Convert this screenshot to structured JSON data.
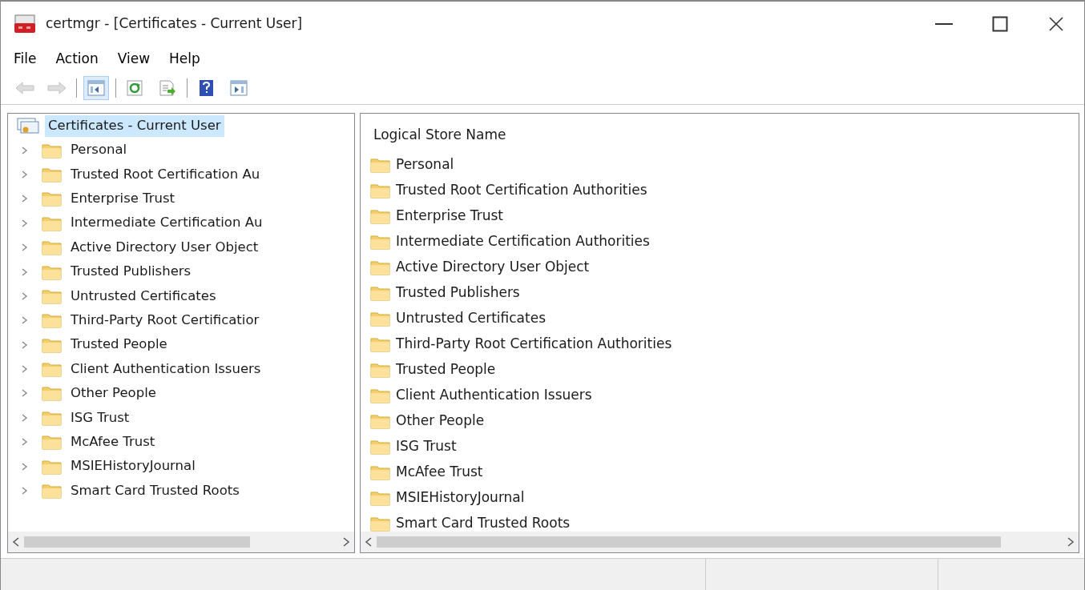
{
  "window": {
    "title": "certmgr - [Certificates - Current User]"
  },
  "menu": [
    "File",
    "Action",
    "View",
    "Help"
  ],
  "toolbar": [
    {
      "kind": "back",
      "disabled": true,
      "pressed": false
    },
    {
      "kind": "forward",
      "disabled": true,
      "pressed": false
    },
    {
      "kind": "separator"
    },
    {
      "kind": "tree",
      "disabled": false,
      "pressed": true
    },
    {
      "kind": "separator"
    },
    {
      "kind": "refresh",
      "disabled": false,
      "pressed": false
    },
    {
      "kind": "export",
      "disabled": false,
      "pressed": false
    },
    {
      "kind": "separator"
    },
    {
      "kind": "help",
      "disabled": false,
      "pressed": false
    },
    {
      "kind": "actionpane",
      "disabled": false,
      "pressed": false
    }
  ],
  "tree": {
    "label": "Certificates - Current User",
    "selected": true,
    "children": [
      {
        "label": "Personal",
        "expanded": false,
        "selected": false
      },
      {
        "label": "Trusted Root Certification Au",
        "expanded": false,
        "selected": false
      },
      {
        "label": "Enterprise Trust",
        "expanded": false,
        "selected": false
      },
      {
        "label": "Intermediate Certification Au",
        "expanded": false,
        "selected": false
      },
      {
        "label": "Active Directory User Object",
        "expanded": false,
        "selected": false
      },
      {
        "label": "Trusted Publishers",
        "expanded": false,
        "selected": false
      },
      {
        "label": "Untrusted Certificates",
        "expanded": false,
        "selected": false
      },
      {
        "label": "Third-Party Root Certificatior",
        "expanded": false,
        "selected": false
      },
      {
        "label": "Trusted People",
        "expanded": false,
        "selected": false
      },
      {
        "label": "Client Authentication Issuers",
        "expanded": false,
        "selected": false
      },
      {
        "label": "Other People",
        "expanded": false,
        "selected": false
      },
      {
        "label": "ISG Trust",
        "expanded": false,
        "selected": false
      },
      {
        "label": "McAfee Trust",
        "expanded": false,
        "selected": false
      },
      {
        "label": "MSIEHistoryJournal",
        "expanded": false,
        "selected": false
      },
      {
        "label": "Smart Card Trusted Roots",
        "expanded": false,
        "selected": false
      }
    ]
  },
  "list": {
    "columns": [
      "Logical Store Name"
    ],
    "rows": [
      "Personal",
      "Trusted Root Certification Authorities",
      "Enterprise Trust",
      "Intermediate Certification Authorities",
      "Active Directory User Object",
      "Trusted Publishers",
      "Untrusted Certificates",
      "Third-Party Root Certification Authorities",
      "Trusted People",
      "Client Authentication Issuers",
      "Other People",
      "ISG Trust",
      "McAfee Trust",
      "MSIEHistoryJournal",
      "Smart Card Trusted Roots"
    ]
  }
}
